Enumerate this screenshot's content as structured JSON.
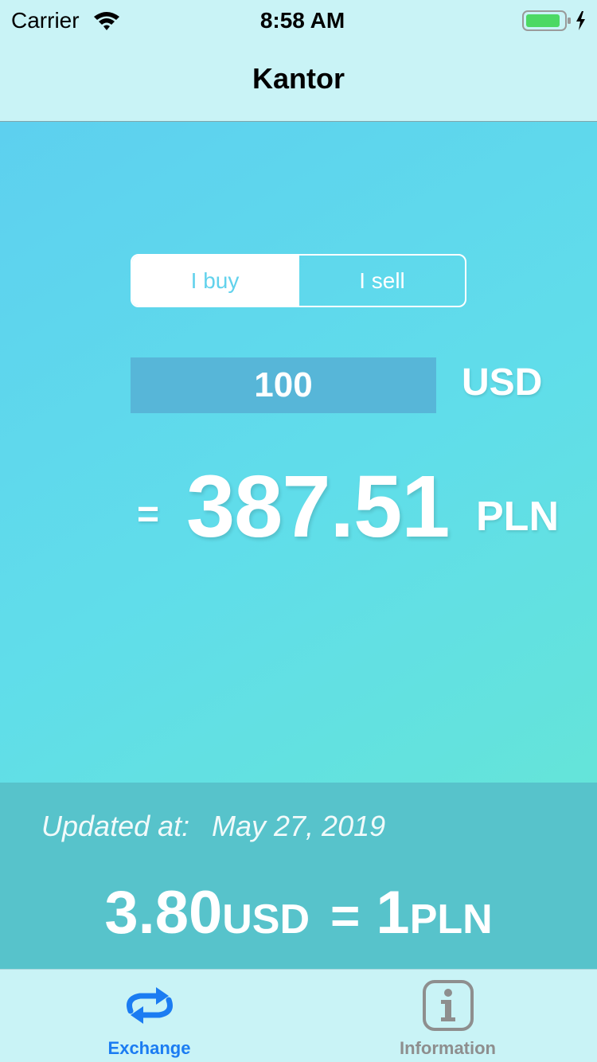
{
  "status_bar": {
    "carrier": "Carrier",
    "time": "8:58 AM",
    "battery_charging": true
  },
  "nav": {
    "title": "Kantor"
  },
  "exchange": {
    "segments": [
      {
        "label": "I buy",
        "selected": true
      },
      {
        "label": "I sell",
        "selected": false
      }
    ],
    "amount": "100",
    "from_currency": "USD",
    "equals": "=",
    "result": "387.51",
    "to_currency": "PLN"
  },
  "rate": {
    "updated_label": "Updated at:",
    "updated_date": "May 27, 2019",
    "left_value": "3.80",
    "left_currency": "USD",
    "equals": "=",
    "right_value": "1",
    "right_currency": "PLN"
  },
  "tabs": [
    {
      "label": "Exchange",
      "icon": "exchange-icon",
      "active": true
    },
    {
      "label": "Information",
      "icon": "info-icon",
      "active": false
    }
  ],
  "colors": {
    "accent": "#1b7cf2",
    "gradient_start": "#5dd0ef",
    "gradient_end": "#64e4d9",
    "rate_panel": "#57c3cb",
    "input_bg": "#57b6d8",
    "bars_bg": "#c9f3f6",
    "inactive_tab": "#8e8e8e"
  }
}
